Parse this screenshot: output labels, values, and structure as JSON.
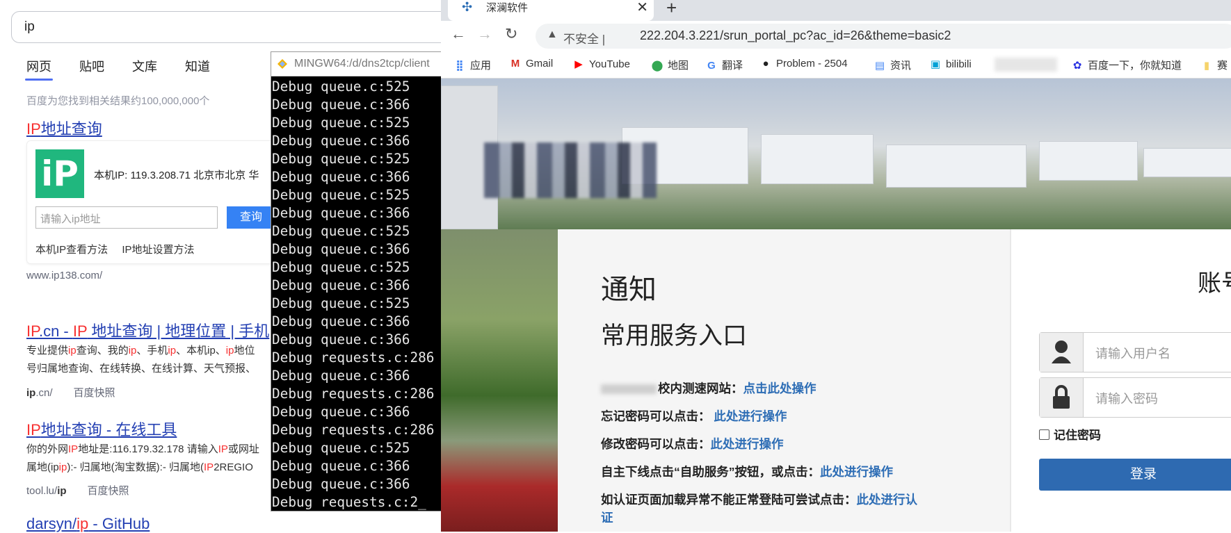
{
  "baidu": {
    "query": "ip",
    "tabs": [
      "网页",
      "贴吧",
      "文库",
      "知道"
    ],
    "result_count": "百度为您找到相关结果约100,000,000个",
    "card": {
      "title_red": "IP",
      "title_rest": "地址查询",
      "logo_text": "iP",
      "ip_line": "本机IP: 119.3.208.71   北京市北京 华",
      "input_placeholder": "请输入ip地址",
      "button": "查询",
      "link1": "本机IP查看方法",
      "link2": "IP地址设置方法",
      "url": "www.ip138.com/"
    },
    "result2": {
      "title_a": "IP",
      "title_b": ".cn - ",
      "title_c": "IP",
      "title_d": " 地址查询 | 地理位置 | 手机",
      "desc1_a": "专业提供",
      "desc1_b": "ip",
      "desc1_c": "查询、我的",
      "desc1_d": "ip",
      "desc1_e": "、手机",
      "desc1_f": "ip",
      "desc1_g": "、本机ip、",
      "desc1_h": "ip",
      "desc1_i": "地位",
      "desc2": "号归属地查询、在线转换、在线计算、天气预报、",
      "url_bold": "ip",
      "url_rest": ".cn/",
      "snapshot": "百度快照"
    },
    "result3": {
      "title_a": "IP",
      "title_b": "地址查询 - 在线工具",
      "desc1_a": "你的外网",
      "desc1_b": "IP",
      "desc1_c": "地址是:116.179.32.178 请输入",
      "desc1_d": "IP",
      "desc1_e": "或网址",
      "desc2_a": "属地(ip",
      "desc2_b": "ip",
      "desc2_c": "):- 归属地(淘宝数据):- 归属地(",
      "desc2_d": "IP",
      "desc2_e": "2REGIO",
      "url_a": "tool.lu/",
      "url_bold": "ip",
      "snapshot": "百度快照"
    },
    "result4": {
      "title_a": "darsyn/",
      "title_b": "ip",
      "title_c": " - GitHub"
    }
  },
  "terminal": {
    "title": "MINGW64:/d/dns2tcp/client",
    "lines": [
      "Debug queue.c:525",
      "Debug queue.c:366",
      "Debug queue.c:525",
      "Debug queue.c:366",
      "Debug queue.c:525",
      "Debug queue.c:366",
      "Debug queue.c:525",
      "Debug queue.c:366",
      "Debug queue.c:525",
      "Debug queue.c:366",
      "Debug queue.c:525",
      "Debug queue.c:366",
      "Debug queue.c:525",
      "Debug queue.c:366",
      "Debug queue.c:366",
      "Debug requests.c:286",
      "Debug queue.c:366",
      "Debug requests.c:286",
      "Debug queue.c:366",
      "Debug requests.c:286",
      "Debug queue.c:525",
      "Debug queue.c:366",
      "Debug queue.c:366",
      "Debug requests.c:2_"
    ]
  },
  "chrome": {
    "tab_title": "深澜软件",
    "security_label": "不安全 |",
    "url": "222.204.3.221/srun_portal_pc?ac_id=26&theme=basic2",
    "bookmarks": [
      "应用",
      "Gmail",
      "YouTube",
      "地图",
      "翻译",
      "Problem - 2504",
      "资讯",
      "bilibili",
      "百度一下，你就知道",
      "赛"
    ]
  },
  "portal": {
    "notice_title": "通知",
    "services_title": "常用服务入口",
    "rows": [
      {
        "text": "校内测速网站：",
        "link": "点击此处操作"
      },
      {
        "text": "忘记密码可以点击： ",
        "link": "此处进行操作"
      },
      {
        "text": "修改密码可以点击：",
        "link": "此处进行操作"
      },
      {
        "text": "自主下线点击“自助服务”按钮，或点击：",
        "link": "此处进行操作"
      },
      {
        "text": "如认证页面加载异常不能正常登陆可尝试点击：",
        "link": "此处进行认"
      },
      {
        "text": "",
        "link": "证"
      }
    ],
    "login_title": "账号",
    "username_placeholder": "请输入用户名",
    "password_placeholder": "请输入密码",
    "remember": "记住密码",
    "login_button": "登录"
  }
}
